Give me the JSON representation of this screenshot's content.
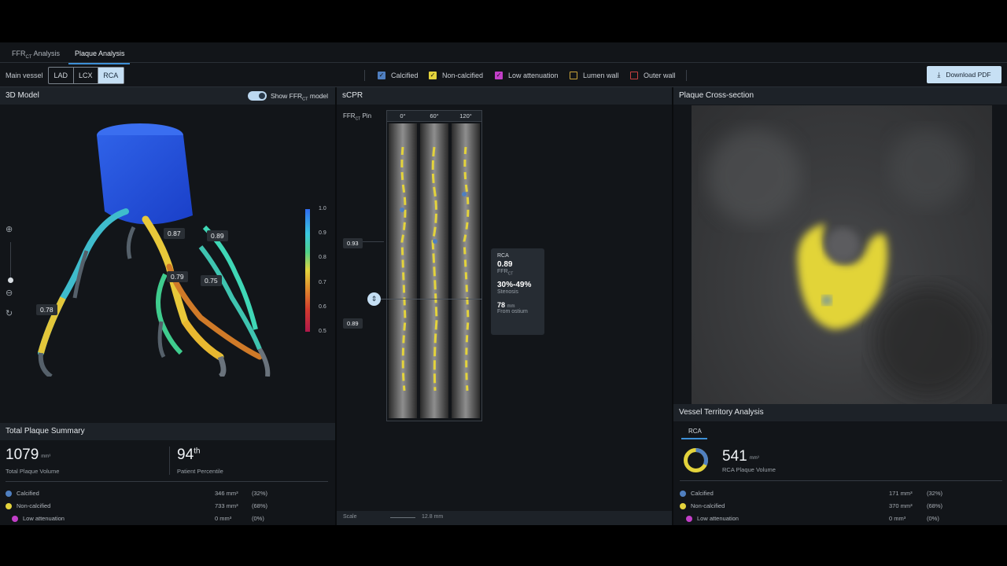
{
  "tabs": [
    {
      "label_main": "FFR",
      "label_sub": "CT",
      "label_tail": " Analysis"
    },
    {
      "label": "Plaque Analysis"
    }
  ],
  "toolbar": {
    "main_vessel_label": "Main vessel",
    "vessels": [
      "LAD",
      "LCX",
      "RCA"
    ],
    "selected_vessel": "RCA",
    "filters": [
      {
        "label": "Calcified",
        "color": "#4f7fc0",
        "checked": true
      },
      {
        "label": "Non-calcified",
        "color": "#e3d33c",
        "checked": true
      },
      {
        "label": "Low attenuation",
        "color": "#c23fc8",
        "checked": true
      },
      {
        "label": "Lumen wall",
        "color": "#c9a43a",
        "checked": false
      },
      {
        "label": "Outer wall",
        "color": "#c84040",
        "checked": false
      }
    ],
    "download_label": "Download PDF"
  },
  "model_panel": {
    "title": "3D Model",
    "toggle_label_main": "Show FFR",
    "toggle_label_sub": "CT",
    "toggle_label_tail": " model",
    "colorbar_ticks": [
      "1.0",
      "0.9",
      "0.8",
      "0.7",
      "0.6",
      "0.5"
    ],
    "point_labels": [
      "0.87",
      "0.89",
      "0.79",
      "0.75",
      "0.78"
    ]
  },
  "scpr_panel": {
    "title": "sCPR",
    "pin_label_main": "FFR",
    "pin_label_sub": "CT",
    "pin_label_tail": " Pin",
    "angles": [
      "0°",
      "60°",
      "120°"
    ],
    "pin_values": [
      "0.93",
      "0.89"
    ],
    "scale_label": "Scale",
    "scale_value": "12.8 mm",
    "tooltip": {
      "vessel": "RCA",
      "ffr": "0.89",
      "ffr_label_main": "FFR",
      "ffr_label_sub": "CT",
      "stenosis": "30%-49%",
      "stenosis_label": "Stenosis",
      "distance": "78",
      "distance_unit": "mm",
      "distance_label": "From ostium"
    }
  },
  "cross_section_panel": {
    "title": "Plaque Cross-section"
  },
  "total_summary": {
    "title": "Total Plaque Summary",
    "volume": "1079",
    "volume_unit": "mm³",
    "volume_label": "Total Plaque Volume",
    "percentile": "94",
    "percentile_suffix": "th",
    "percentile_label": "Patient Percentile",
    "rows": [
      {
        "label": "Calcified",
        "color": "#4f7fc0",
        "value": "346 mm³",
        "pct": "(32%)"
      },
      {
        "label": "Non-calcified",
        "color": "#e3d33c",
        "value": "733 mm³",
        "pct": "(68%)"
      },
      {
        "label": "Low attenuation",
        "color": "#c23fc8",
        "value": "0 mm³",
        "pct": "(0%)"
      }
    ]
  },
  "territory": {
    "title": "Vessel Territory Analysis",
    "tab": "RCA",
    "volume": "541",
    "volume_unit": "mm³",
    "volume_label": "RCA Plaque Volume",
    "donut": {
      "calcified_fraction": 0.32,
      "noncalcified_fraction": 0.68
    },
    "rows": [
      {
        "label": "Calcified",
        "color": "#4f7fc0",
        "value": "171 mm³",
        "pct": "(32%)"
      },
      {
        "label": "Non-calcified",
        "color": "#e3d33c",
        "value": "370 mm³",
        "pct": "(68%)"
      },
      {
        "label": "Low attenuation",
        "color": "#c23fc8",
        "value": "0 mm³",
        "pct": "(0%)"
      }
    ]
  }
}
